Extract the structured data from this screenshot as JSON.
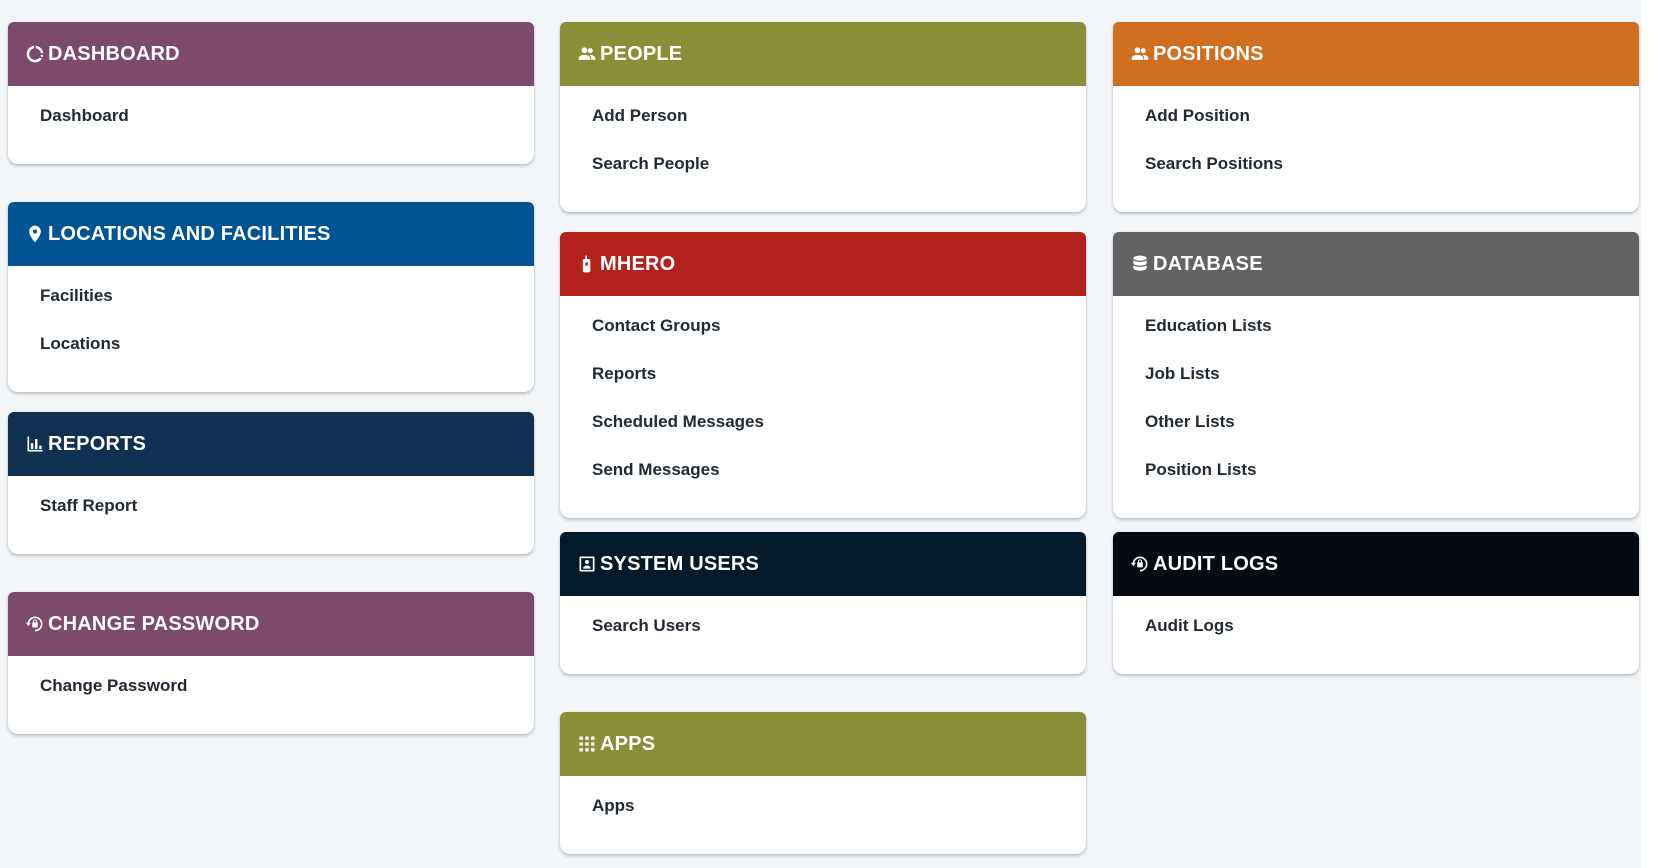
{
  "colors": {
    "purple": "#7b4a6c",
    "blue": "#005494",
    "navy": "#0f3050",
    "olive": "#8a8e37",
    "red": "#b2211c",
    "dark_navy": "#031a2c",
    "orange": "#cf6f1f",
    "gray": "#636364",
    "black": "#060a11"
  },
  "cards": {
    "dashboard": {
      "title": "DASHBOARD",
      "icon": "dashboard-icon",
      "links": [
        "Dashboard"
      ]
    },
    "locations": {
      "title": "LOCATIONS AND FACILITIES",
      "icon": "location-pin-icon",
      "links": [
        "Facilities",
        "Locations"
      ]
    },
    "reports": {
      "title": "REPORTS",
      "icon": "bar-chart-icon",
      "links": [
        "Staff Report"
      ]
    },
    "change_password": {
      "title": "CHANGE PASSWORD",
      "icon": "lock-reset-icon",
      "links": [
        "Change Password"
      ]
    },
    "people": {
      "title": "PEOPLE",
      "icon": "people-icon",
      "links": [
        "Add Person",
        "Search People"
      ]
    },
    "mhero": {
      "title": "MHERO",
      "icon": "radio-icon",
      "links": [
        "Contact Groups",
        "Reports",
        "Scheduled Messages",
        "Send Messages"
      ]
    },
    "system_users": {
      "title": "SYSTEM USERS",
      "icon": "user-card-icon",
      "links": [
        "Search Users"
      ]
    },
    "apps": {
      "title": "APPS",
      "icon": "apps-grid-icon",
      "links": [
        "Apps"
      ]
    },
    "positions": {
      "title": "POSITIONS",
      "icon": "people-icon",
      "links": [
        "Add Position",
        "Search Positions"
      ]
    },
    "database": {
      "title": "DATABASE",
      "icon": "database-icon",
      "links": [
        "Education Lists",
        "Job Lists",
        "Other Lists",
        "Position Lists"
      ]
    },
    "audit_logs": {
      "title": "AUDIT LOGS",
      "icon": "lock-reset-icon",
      "links": [
        "Audit Logs"
      ]
    }
  }
}
